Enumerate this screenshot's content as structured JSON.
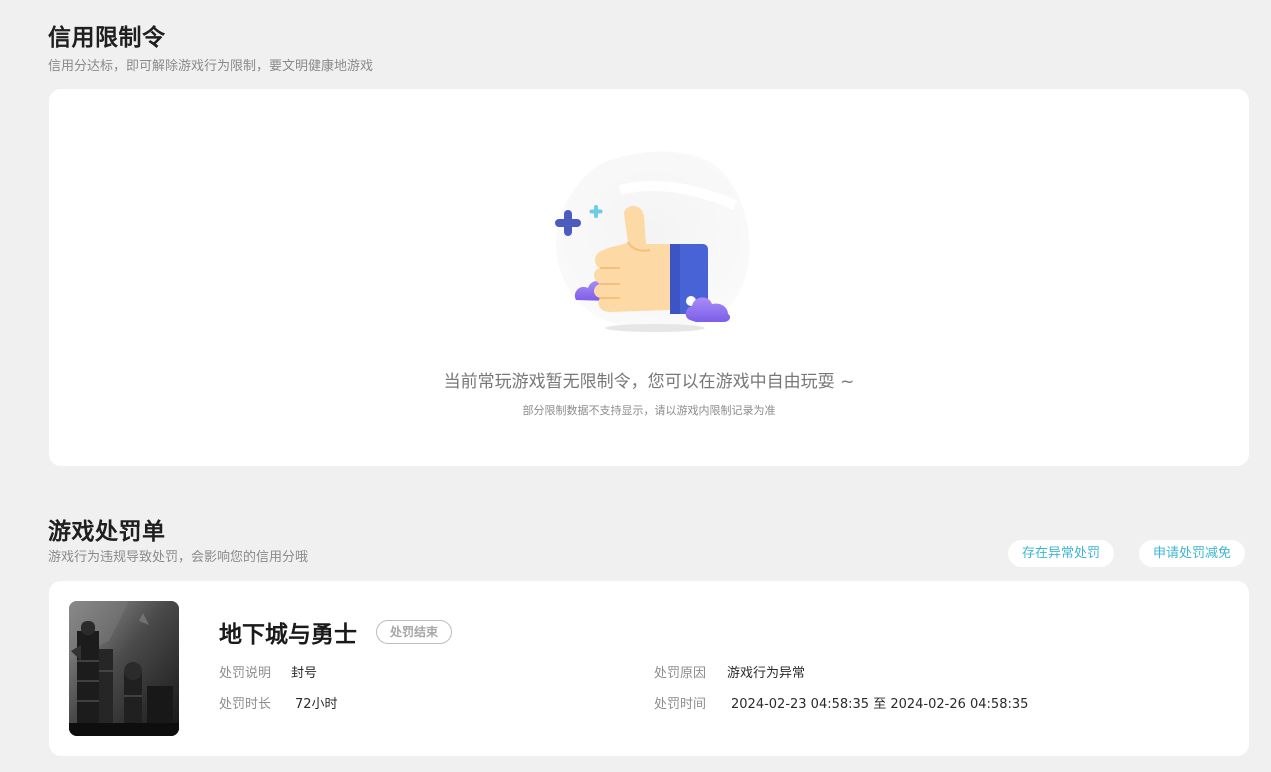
{
  "credit_restriction": {
    "title": "信用限制令",
    "subtitle": "信用分达标，即可解除游戏行为限制，要文明健康地游戏",
    "empty_message": "当前常玩游戏暂无限制令，您可以在游戏中自由玩耍 ~",
    "empty_note": "部分限制数据不支持显示，请以游戏内限制记录为准",
    "illustration_icon": "thumbs-up-icon"
  },
  "penalty": {
    "title": "游戏处罚单",
    "subtitle": "游戏行为违规导致处罚，会影响您的信用分哦",
    "buttons": {
      "abnormal": "存在异常处罚",
      "reduce": "申请处罚减免"
    },
    "records": [
      {
        "game_name": "地下城与勇士",
        "status": "处罚结束",
        "desc_label": "处罚说明",
        "desc_value": "封号",
        "reason_label": "处罚原因",
        "reason_value": "游戏行为异常",
        "duration_label": "处罚时长",
        "duration_value": "72小时",
        "time_label": "处罚时间",
        "time_value": "2024-02-23 04:58:35 至 2024-02-26 04:58:35"
      }
    ]
  },
  "colors": {
    "background": "#f0f0f0",
    "card": "#ffffff",
    "accent": "#3db6d3",
    "thumb_skin": "#fcd9a5",
    "cuff_blue": "#4763d6",
    "cloud_purple": "#8f72f2"
  }
}
